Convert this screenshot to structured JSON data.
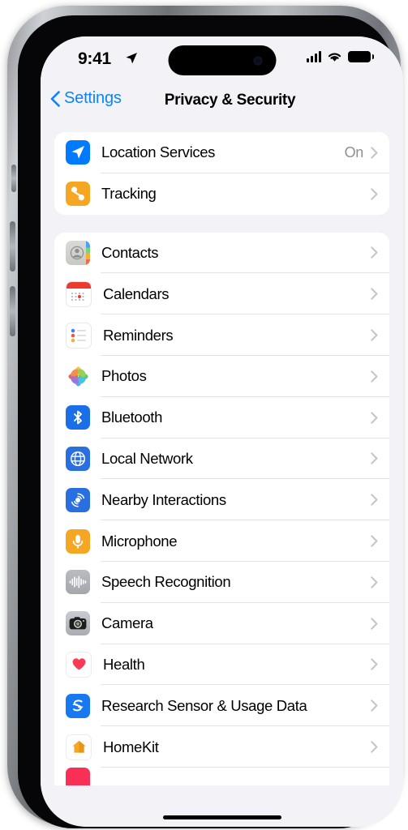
{
  "device": {
    "name": "iPhone",
    "frame_color": "#9a9da1"
  },
  "status_bar": {
    "time": "9:41",
    "location_icon": "location-arrow-icon",
    "signal_icon": "cellular-signal-icon",
    "signal_bars": 4,
    "wifi_icon": "wifi-icon",
    "battery_icon": "battery-full-icon"
  },
  "navbar": {
    "back_icon": "chevron-left-icon",
    "back_label": "Settings",
    "title": "Privacy & Security"
  },
  "colors": {
    "accent_blue": "#0a84ff",
    "page_background": "#f2f2f7",
    "card_background": "#ffffff",
    "separator": "#e4e4e7",
    "secondary_text": "#8e8e93"
  },
  "groups": [
    {
      "id": "group-services",
      "rows": [
        {
          "label": "Location Services",
          "value": "On",
          "icon": "location-services-icon",
          "icon_class": "ic-location"
        },
        {
          "label": "Tracking",
          "value": "",
          "icon": "tracking-icon",
          "icon_class": "ic-tracking"
        }
      ]
    },
    {
      "id": "group-permissions",
      "rows": [
        {
          "label": "Contacts",
          "value": "",
          "icon": "contacts-icon",
          "icon_class": "ic-contacts"
        },
        {
          "label": "Calendars",
          "value": "",
          "icon": "calendars-icon",
          "icon_class": "ic-calendars"
        },
        {
          "label": "Reminders",
          "value": "",
          "icon": "reminders-icon",
          "icon_class": "ic-reminders"
        },
        {
          "label": "Photos",
          "value": "",
          "icon": "photos-icon",
          "icon_class": "ic-photos"
        },
        {
          "label": "Bluetooth",
          "value": "",
          "icon": "bluetooth-icon",
          "icon_class": "ic-bluetooth"
        },
        {
          "label": "Local Network",
          "value": "",
          "icon": "local-network-icon",
          "icon_class": "ic-localnet"
        },
        {
          "label": "Nearby Interactions",
          "value": "",
          "icon": "nearby-interactions-icon",
          "icon_class": "ic-nearby"
        },
        {
          "label": "Microphone",
          "value": "",
          "icon": "microphone-icon",
          "icon_class": "ic-microphone"
        },
        {
          "label": "Speech Recognition",
          "value": "",
          "icon": "speech-recognition-icon",
          "icon_class": "ic-speech"
        },
        {
          "label": "Camera",
          "value": "",
          "icon": "camera-icon",
          "icon_class": "ic-camera"
        },
        {
          "label": "Health",
          "value": "",
          "icon": "health-icon",
          "icon_class": "ic-health"
        },
        {
          "label": "Research Sensor & Usage Data",
          "value": "",
          "icon": "research-sensor-icon",
          "icon_class": "ic-research"
        },
        {
          "label": "HomeKit",
          "value": "",
          "icon": "homekit-icon",
          "icon_class": "ic-homekit"
        }
      ]
    }
  ],
  "home_indicator": "home-indicator"
}
